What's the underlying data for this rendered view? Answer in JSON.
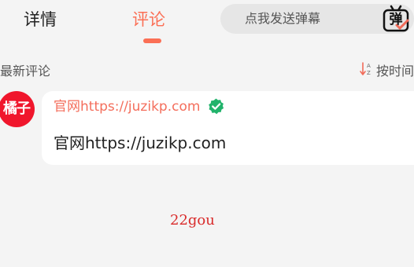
{
  "tabs": [
    {
      "label": "详情",
      "active": false
    },
    {
      "label": "评论",
      "active": true
    }
  ],
  "danmaku": {
    "placeholder": "点我发送弹幕",
    "icon_glyph": "弹"
  },
  "comments_section": {
    "title": "最新评论",
    "sort_label": "按时间"
  },
  "comment": {
    "avatar_text": "橘子",
    "author": "官网https://juzikp.com",
    "text": "官网https://juzikp.com"
  },
  "footer": {
    "text": "22gou"
  },
  "colors": {
    "accent": "#fb6f55",
    "author": "#f46e5c",
    "avatar_bg": "#f0162c",
    "verified": "#21b36b",
    "footer_text": "#d92b2b"
  },
  "icons": [
    "danmaku-icon",
    "sort-icon",
    "verified-icon"
  ]
}
